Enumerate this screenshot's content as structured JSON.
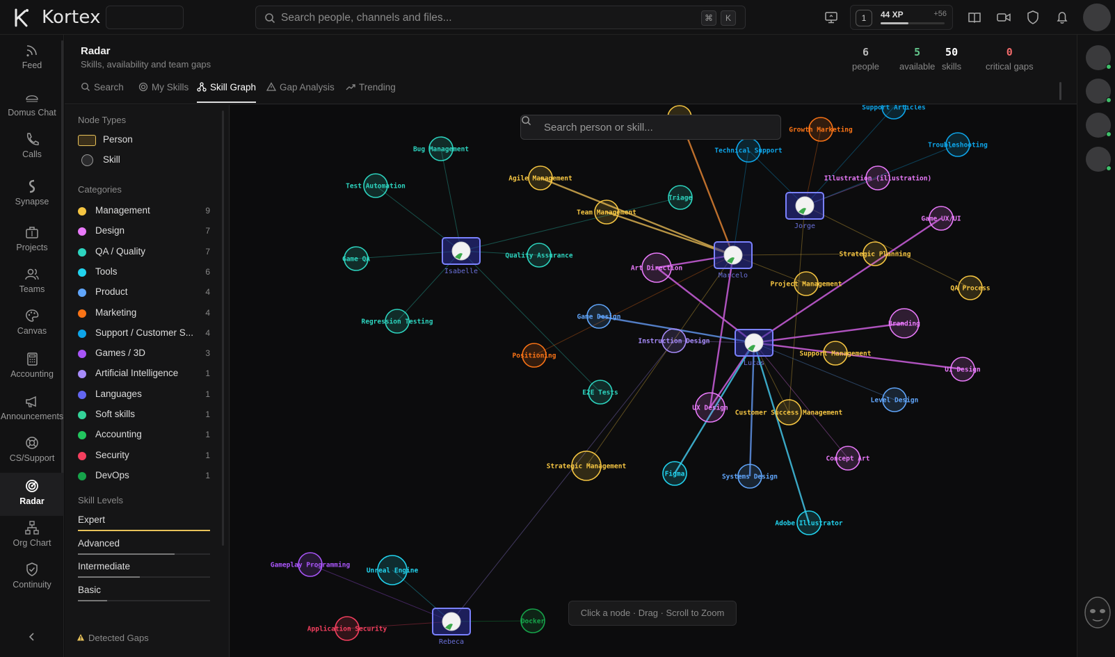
{
  "app": {
    "brand": "Kortex",
    "search_placeholder": "Search people, channels and files...",
    "shortcut_keys": [
      "⌘",
      "K"
    ],
    "icons": [
      "screen-share-icon",
      "book-icon",
      "video-icon",
      "shield-icon",
      "bell-icon"
    ]
  },
  "xp": {
    "level": "1",
    "value": "44 XP",
    "delta": "+56",
    "progress": 0.44
  },
  "nav": [
    {
      "label": "Feed",
      "icon": "rss-icon"
    },
    {
      "label": "Domus Chat",
      "icon": "domus-icon"
    },
    {
      "label": "Calls",
      "icon": "phone-icon"
    },
    {
      "label": "Synapse",
      "icon": "synapse-icon"
    },
    {
      "label": "Projects",
      "icon": "briefcase-icon"
    },
    {
      "label": "Teams",
      "icon": "users-icon"
    },
    {
      "label": "Canvas",
      "icon": "palette-icon"
    },
    {
      "label": "Accounting",
      "icon": "calculator-icon"
    },
    {
      "label": "Announcements",
      "icon": "megaphone-icon"
    },
    {
      "label": "CS/Support",
      "icon": "lifebuoy-icon"
    },
    {
      "label": "Radar",
      "icon": "radar-icon",
      "active": true
    },
    {
      "label": "Org Chart",
      "icon": "org-chart-icon"
    },
    {
      "label": "Continuity",
      "icon": "shield-check-icon"
    }
  ],
  "page": {
    "title": "Radar",
    "subtitle": "Skills, availability and team gaps"
  },
  "stats": [
    {
      "value": "6",
      "label": "people",
      "color": "#b8b8b8"
    },
    {
      "value": "5",
      "label": "available",
      "color": "#62c48a"
    },
    {
      "value": "50",
      "label": "skills",
      "color": "#ffffff"
    },
    {
      "value": "0",
      "label": "critical gaps",
      "color": "#f06a6a"
    }
  ],
  "tabs": [
    {
      "label": "Search",
      "icon": "search-icon"
    },
    {
      "label": "My Skills",
      "icon": "target-icon"
    },
    {
      "label": "Skill Graph",
      "icon": "graph-icon",
      "active": true
    },
    {
      "label": "Gap Analysis",
      "icon": "warning-icon"
    },
    {
      "label": "Trending",
      "icon": "trending-icon"
    }
  ],
  "sidebar": {
    "node_types_title": "Node Types",
    "node_types": [
      "Person",
      "Skill"
    ],
    "categories_title": "Categories",
    "categories": [
      {
        "name": "Management",
        "count": "9",
        "color": "#f5c542"
      },
      {
        "name": "Design",
        "count": "7",
        "color": "#e879f9"
      },
      {
        "name": "QA / Quality",
        "count": "7",
        "color": "#2dd4bf"
      },
      {
        "name": "Tools",
        "count": "6",
        "color": "#22d3ee"
      },
      {
        "name": "Product",
        "count": "4",
        "color": "#60a5fa"
      },
      {
        "name": "Marketing",
        "count": "4",
        "color": "#f97316"
      },
      {
        "name": "Support / Customer S...",
        "count": "4",
        "color": "#0ea5e9"
      },
      {
        "name": "Games / 3D",
        "count": "3",
        "color": "#a855f7"
      },
      {
        "name": "Artificial Intelligence",
        "count": "1",
        "color": "#a78bfa"
      },
      {
        "name": "Languages",
        "count": "1",
        "color": "#6366f1"
      },
      {
        "name": "Soft skills",
        "count": "1",
        "color": "#34d399"
      },
      {
        "name": "Accounting",
        "count": "1",
        "color": "#22c55e"
      },
      {
        "name": "Security",
        "count": "1",
        "color": "#f43f5e"
      },
      {
        "name": "DevOps",
        "count": "1",
        "color": "#16a34a"
      }
    ],
    "levels_title": "Skill Levels",
    "levels": [
      {
        "name": "Expert",
        "fill": 1.0,
        "color": "#e8c25a"
      },
      {
        "name": "Advanced",
        "fill": 0.73,
        "color": "#777777"
      },
      {
        "name": "Intermediate",
        "fill": 0.47,
        "color": "#777777"
      },
      {
        "name": "Basic",
        "fill": 0.22,
        "color": "#777777"
      }
    ],
    "gaps_label": "Detected Gaps"
  },
  "graph": {
    "search_placeholder": "Search person or skill...",
    "hint": "Click a node · Drag · Scroll to Zoom",
    "people": [
      {
        "id": "isabelle",
        "name": "Isabelle"
      },
      {
        "id": "marcelo",
        "name": "Marcelo"
      },
      {
        "id": "jorge",
        "name": "Jorge"
      },
      {
        "id": "lucas",
        "name": "Lucas"
      },
      {
        "id": "rebeca",
        "name": "Rebeca"
      }
    ],
    "skills": [
      {
        "id": "bug-mgmt",
        "name": "Bug Management",
        "category": "QA / Quality"
      },
      {
        "id": "test-auto",
        "name": "Test Automation",
        "category": "QA / Quality"
      },
      {
        "id": "game-qa",
        "name": "Game QA",
        "category": "QA / Quality"
      },
      {
        "id": "qa-assur",
        "name": "Quality Assurance",
        "category": "QA / Quality"
      },
      {
        "id": "regression",
        "name": "Regression Testing",
        "category": "QA / Quality"
      },
      {
        "id": "e2e",
        "name": "E2E Tests",
        "category": "QA / Quality"
      },
      {
        "id": "triage",
        "name": "Triage",
        "category": "QA / Quality"
      },
      {
        "id": "agile",
        "name": "Agile Management",
        "category": "Management"
      },
      {
        "id": "team-mgmt",
        "name": "Team Management",
        "category": "Management"
      },
      {
        "id": "strat-plan",
        "name": "Strategic Planning",
        "category": "Management"
      },
      {
        "id": "proj-mgmt",
        "name": "Project Management",
        "category": "Management"
      },
      {
        "id": "qa-process",
        "name": "QA Process",
        "category": "Management"
      },
      {
        "id": "support-mgmt",
        "name": "Support Management",
        "category": "Management"
      },
      {
        "id": "csm",
        "name": "Customer Success Management",
        "category": "Management"
      },
      {
        "id": "strat-mgmt",
        "name": "Strategic Management",
        "category": "Management"
      },
      {
        "id": "top-yellow",
        "name": "",
        "category": "Management"
      },
      {
        "id": "art-dir",
        "name": "Art Direction",
        "category": "Design"
      },
      {
        "id": "illus",
        "name": "Illustration (illustration)",
        "category": "Design"
      },
      {
        "id": "game-ux",
        "name": "Game UX/UI",
        "category": "Design"
      },
      {
        "id": "branding",
        "name": "Branding",
        "category": "Design"
      },
      {
        "id": "ui-design",
        "name": "UI Design",
        "category": "Design"
      },
      {
        "id": "ux-design",
        "name": "UX Design",
        "category": "Design"
      },
      {
        "id": "concept",
        "name": "Concept Art",
        "category": "Design"
      },
      {
        "id": "figma",
        "name": "Figma",
        "category": "Tools"
      },
      {
        "id": "adobe",
        "name": "Adobe Illustrator",
        "category": "Tools"
      },
      {
        "id": "unreal",
        "name": "Unreal Engine",
        "category": "Tools"
      },
      {
        "id": "game-design",
        "name": "Game Design",
        "category": "Product"
      },
      {
        "id": "level-design",
        "name": "Level Design",
        "category": "Product"
      },
      {
        "id": "sys-design",
        "name": "Systems Design",
        "category": "Product"
      },
      {
        "id": "growth",
        "name": "Growth Marketing",
        "category": "Marketing"
      },
      {
        "id": "positioning",
        "name": "Positioning",
        "category": "Marketing"
      },
      {
        "id": "support-art",
        "name": "Support Articles",
        "category": "Support / Customer S..."
      },
      {
        "id": "tech-support",
        "name": "Technical Support",
        "category": "Support / Customer S..."
      },
      {
        "id": "trouble",
        "name": "Troubleshooting",
        "category": "Support / Customer S..."
      },
      {
        "id": "gameplay",
        "name": "Gameplay Programming",
        "category": "Games / 3D"
      },
      {
        "id": "instr-design",
        "name": "Instruction Design",
        "category": "Artificial Intelligence"
      },
      {
        "id": "app-sec",
        "name": "Application Security",
        "category": "Security"
      },
      {
        "id": "docker",
        "name": "Docker",
        "category": "DevOps"
      }
    ]
  }
}
